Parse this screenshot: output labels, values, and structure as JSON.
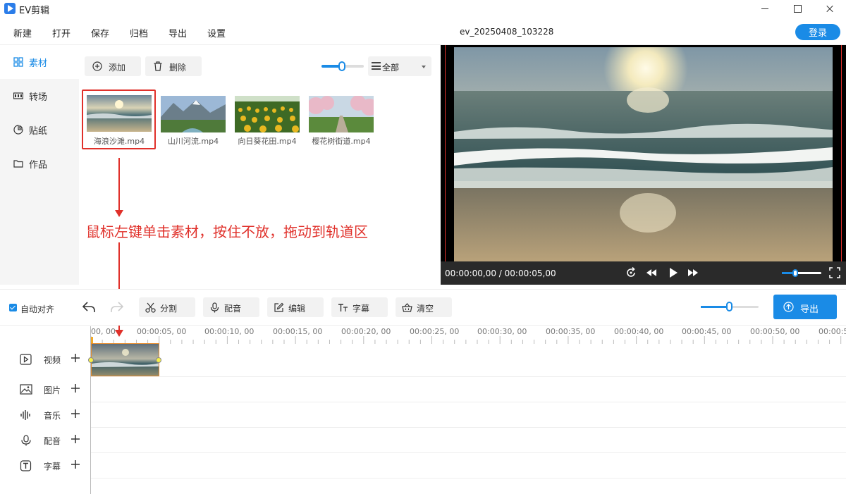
{
  "app": {
    "title": "EV剪辑"
  },
  "menu": {
    "items": [
      "新建",
      "打开",
      "保存",
      "归档",
      "导出",
      "设置"
    ],
    "project_name": "ev_20250408_103228",
    "login_label": "登录"
  },
  "sidebar": {
    "items": [
      {
        "label": "素材",
        "icon": "grid-icon",
        "active": true
      },
      {
        "label": "转场",
        "icon": "film-icon",
        "active": false
      },
      {
        "label": "贴纸",
        "icon": "sticker-icon",
        "active": false
      },
      {
        "label": "作品",
        "icon": "folder-icon",
        "active": false
      }
    ]
  },
  "media": {
    "add_label": "添加",
    "delete_label": "删除",
    "filter_value": "全部",
    "thumb_size_level": 0.5,
    "items": [
      {
        "name": "海浪沙滩.mp4",
        "selected": true
      },
      {
        "name": "山川河流.mp4",
        "selected": false
      },
      {
        "name": "向日葵花田.mp4",
        "selected": false
      },
      {
        "name": "樱花树街道.mp4",
        "selected": false
      }
    ]
  },
  "tutorial": {
    "instruction": "鼠标左键单击素材，按住不放，拖动到轨道区"
  },
  "preview": {
    "time_display": "00:00:00,00 / 00:00:05,00",
    "volume_level": 0.35
  },
  "timeline_toolbar": {
    "auto_align_label": "自动对齐",
    "auto_align_checked": true,
    "split_label": "分割",
    "voiceover_label": "配音",
    "edit_label": "编辑",
    "subtitle_label": "字幕",
    "clear_label": "清空",
    "zoom_level": 0.5,
    "export_label": "导出"
  },
  "ruler": {
    "labels": [
      "00, 00",
      "00:00:05, 00",
      "00:00:10, 00",
      "00:00:15, 00",
      "00:00:20, 00",
      "00:00:25, 00",
      "00:00:30, 00",
      "00:00:35, 00",
      "00:00:40, 00",
      "00:00:45, 00",
      "00:00:50, 00",
      "00:00:55"
    ]
  },
  "tracks": [
    {
      "label": "视频",
      "icon": "video-icon"
    },
    {
      "label": "图片",
      "icon": "image-icon"
    },
    {
      "label": "音乐",
      "icon": "music-icon"
    },
    {
      "label": "配音",
      "icon": "microphone-icon"
    },
    {
      "label": "字幕",
      "icon": "text-icon"
    }
  ],
  "colors": {
    "accent": "#1a8be6",
    "annotation_red": "#e0302a",
    "clip_border": "#e58c2e"
  }
}
